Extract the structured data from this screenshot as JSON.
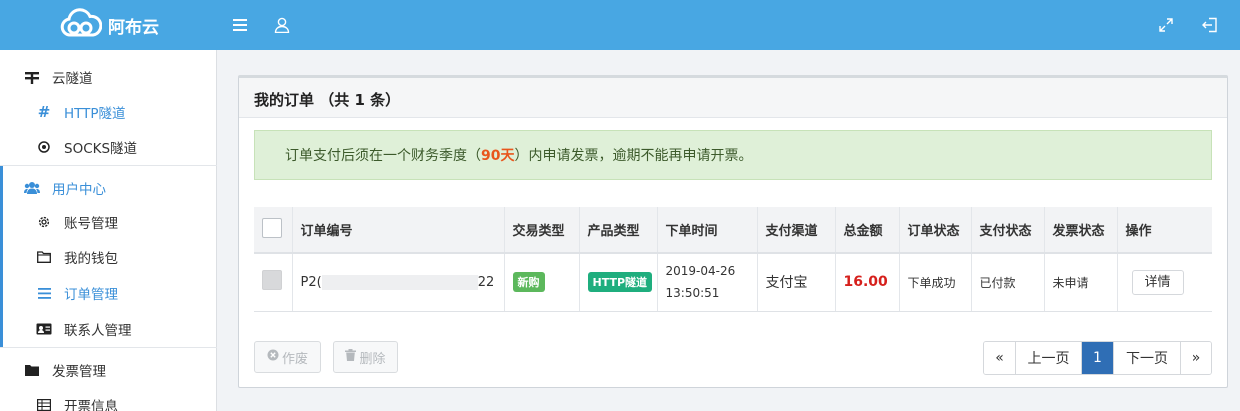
{
  "header": {
    "brand": "阿布云"
  },
  "sidebar": {
    "groups": [
      {
        "label": "云隧道",
        "items": [
          {
            "label": "HTTP隧道"
          },
          {
            "label": "SOCKS隧道"
          }
        ]
      },
      {
        "label": "用户中心",
        "items": [
          {
            "label": "账号管理"
          },
          {
            "label": "我的钱包"
          },
          {
            "label": "订单管理"
          },
          {
            "label": "联系人管理"
          }
        ]
      },
      {
        "label": "发票管理",
        "items": [
          {
            "label": "开票信息"
          }
        ]
      }
    ]
  },
  "main": {
    "title": "我的订单 （共 1 条）",
    "alert": {
      "before": "订单支付后须在一个财务季度（",
      "highlight": "90天",
      "after": "）内申请发票，逾期不能再申请开票。"
    },
    "table": {
      "headers": [
        "订单编号",
        "交易类型",
        "产品类型",
        "下单时间",
        "支付渠道",
        "总金额",
        "订单状态",
        "支付状态",
        "发票状态",
        "操作"
      ],
      "rows": [
        {
          "order_prefix": "P2(",
          "order_suffix": "22",
          "trade_type": "新购",
          "product_type": "HTTP隧道",
          "date": "2019-04-26",
          "time": "13:50:51",
          "channel": "支付宝",
          "amount": "16.00",
          "order_status": "下单成功",
          "pay_status": "已付款",
          "invoice_status": "未申请",
          "action": "详情"
        }
      ]
    },
    "buttons": {
      "void": "作废",
      "delete": "删除"
    },
    "pager": {
      "first": "«",
      "prev": "上一页",
      "current": "1",
      "next": "下一页",
      "last": "»"
    }
  }
}
